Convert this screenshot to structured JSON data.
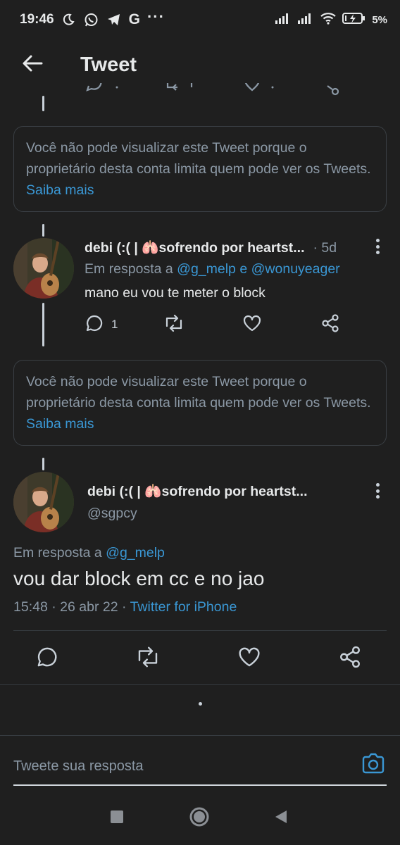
{
  "status_bar": {
    "time": "19:46",
    "google_letter": "G",
    "overflow": "···",
    "battery_percent": "5%",
    "icons": [
      "moon-icon",
      "whatsapp-icon",
      "telegram-icon",
      "google-icon",
      "signal-icon",
      "signal-icon",
      "wifi-icon",
      "battery-icon"
    ]
  },
  "header": {
    "title": "Tweet"
  },
  "notices": [
    {
      "text": "Você não pode visualizar este Tweet porque o proprietário desta conta limita quem pode ver os Tweets.",
      "link": "Saiba mais"
    },
    {
      "text": "Você não pode visualizar este Tweet porque o proprietário desta conta limita quem pode ver os Tweets.",
      "link": "Saiba mais"
    }
  ],
  "reply_tweet": {
    "display_name": "debi (:( | 🫁sofrendo por heartst...",
    "time_ago": "· 5d",
    "reply_prefix": "Em resposta a",
    "reply_user1": "@g_melp",
    "reply_and": "e",
    "reply_user2": "@wonuyeager",
    "text": "mano eu vou te meter o block",
    "reply_count": "1"
  },
  "main_tweet": {
    "display_name": "debi (:( | 🫁sofrendo por heartst...",
    "handle": "@sgpcy",
    "reply_prefix": "Em resposta a",
    "reply_user": "@g_melp",
    "text": "vou dar block em cc e no jao",
    "time": "15:48",
    "date": "26 abr 22",
    "source": "Twitter for iPhone"
  },
  "composer": {
    "placeholder": "Tweete sua resposta"
  },
  "colors": {
    "background": "#1f1f1f",
    "text": "#e7e9ea",
    "muted": "#8b98a5",
    "link": "#3a97d4",
    "border": "#363b40"
  }
}
